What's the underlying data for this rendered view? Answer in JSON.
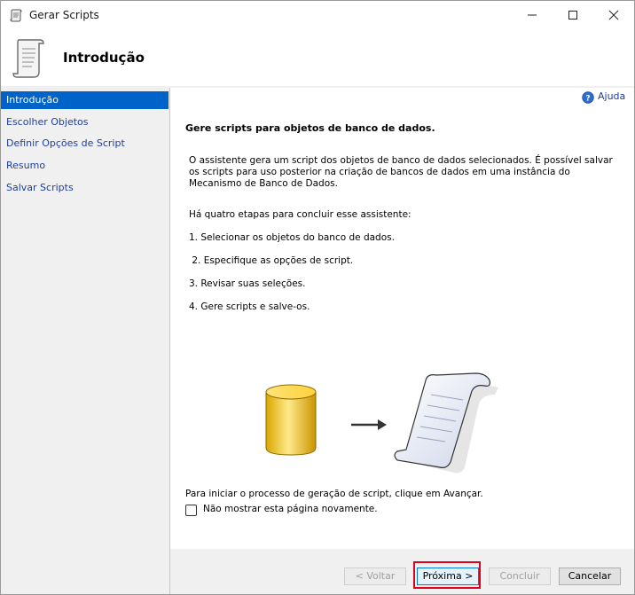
{
  "window": {
    "title": "Gerar Scripts",
    "icon": "script-scroll-icon"
  },
  "header": {
    "title": "Introdução",
    "icon": "scroll-icon"
  },
  "sidebar": {
    "items": [
      {
        "label": "Introdução",
        "active": true
      },
      {
        "label": "Escolher Objetos",
        "active": false
      },
      {
        "label": "Definir Opções de Script",
        "active": false
      },
      {
        "label": "Resumo",
        "active": false
      },
      {
        "label": "Salvar Scripts",
        "active": false
      }
    ]
  },
  "main": {
    "help_label": "Ajuda",
    "heading": "Gere scripts para objetos de banco de dados.",
    "intro": "O assistente gera um script dos objetos de banco de dados selecionados. É possível salvar os scripts para uso posterior na criação de bancos de dados em uma instância do Mecanismo de Banco de Dados.",
    "steps_intro": "Há quatro etapas para concluir esse assistente:",
    "steps": [
      "1. Selecionar os objetos do banco de dados.",
      " 2. Especifique as opções de script.",
      "3. Revisar suas seleções.",
      "4. Gere scripts e salve-os."
    ],
    "footer_text": "Para iniciar o processo de geração de script, clique em Avançar.",
    "checkbox_label": "Não mostrar esta página novamente.",
    "checkbox_checked": false
  },
  "buttons": {
    "back": "< Voltar",
    "next": "Próxima >",
    "finish": "Concluir",
    "cancel": "Cancelar"
  },
  "colors": {
    "accent": "#0063c9",
    "link": "#1f3f99",
    "highlight": "#e0001b"
  }
}
